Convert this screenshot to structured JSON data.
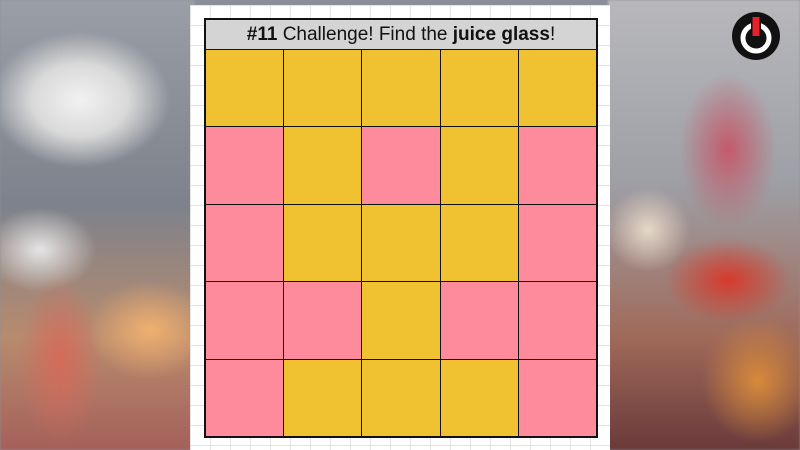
{
  "title": {
    "number": "#11",
    "prefix": " Challenge! Find the ",
    "target": "juice glass",
    "suffix": "!"
  },
  "colors": {
    "yellow": "#f0c232",
    "pink": "#fe8b9c",
    "title_bg": "#d4d4d4",
    "logo_red": "#e8202a"
  },
  "grid": {
    "rows": 5,
    "cols": 5,
    "cells": [
      [
        "yellow",
        "yellow",
        "yellow",
        "yellow",
        "yellow"
      ],
      [
        "pink",
        "yellow",
        "pink",
        "yellow",
        "pink"
      ],
      [
        "pink",
        "yellow",
        "yellow",
        "yellow",
        "pink"
      ],
      [
        "pink",
        "pink",
        "yellow",
        "pink",
        "pink"
      ],
      [
        "pink",
        "yellow",
        "yellow",
        "yellow",
        "pink"
      ]
    ]
  },
  "logo": {
    "icon": "power-icon"
  }
}
